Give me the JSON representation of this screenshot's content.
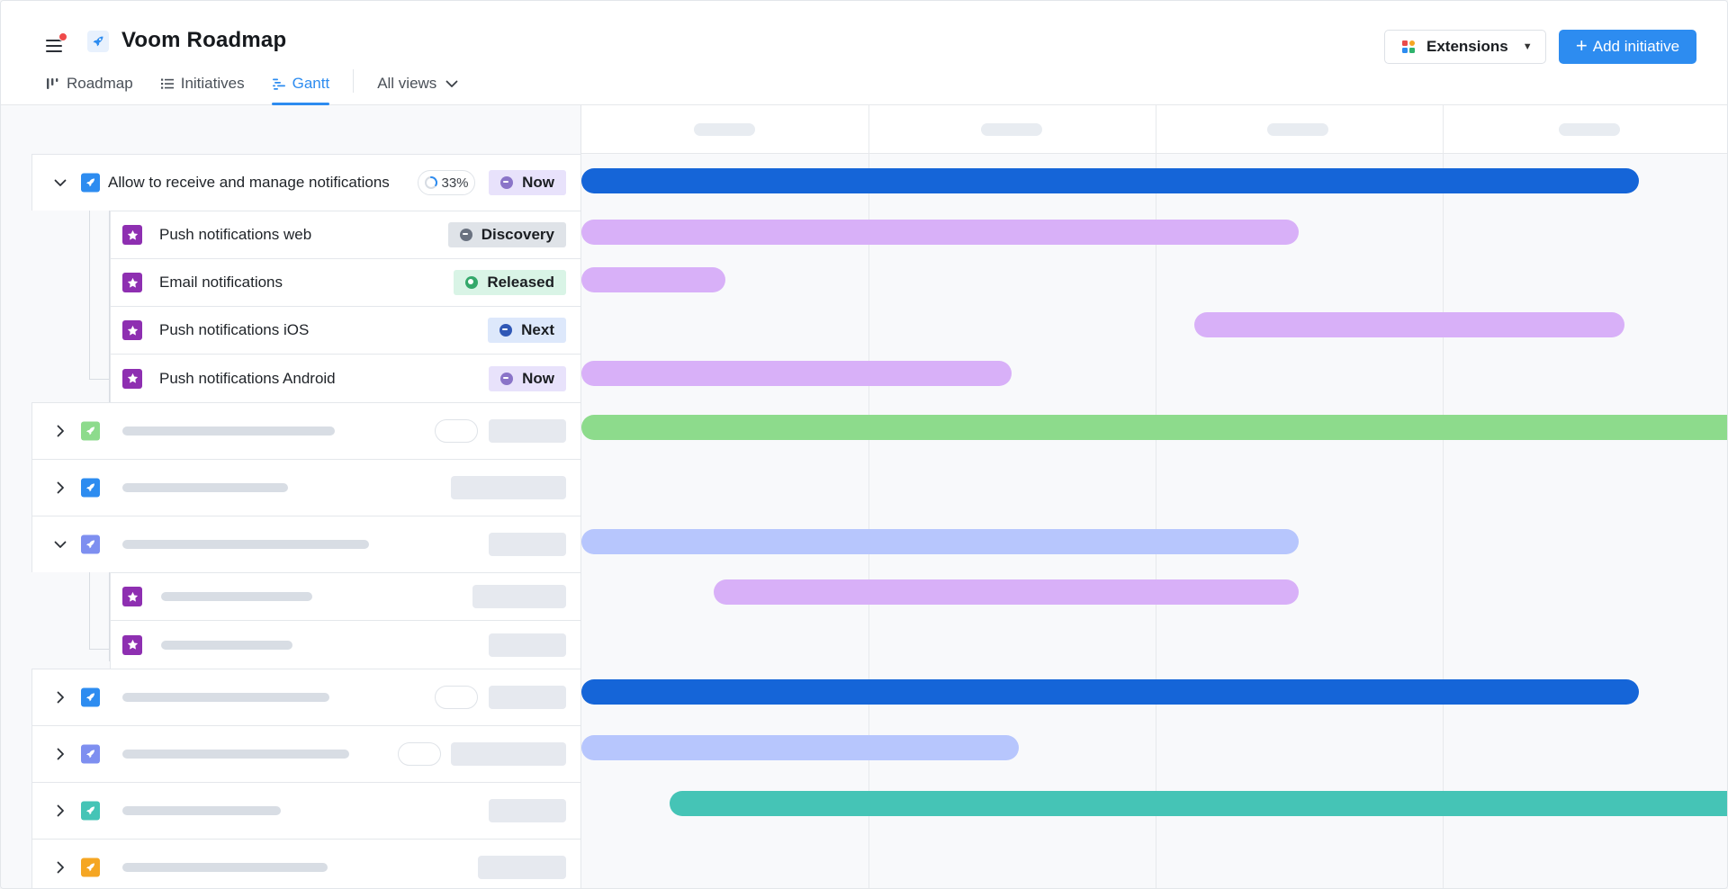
{
  "app": {
    "title": "Voom Roadmap",
    "has_notification": true
  },
  "header": {
    "extensions_label": "Extensions",
    "add_label": "Add initiative"
  },
  "tabs": [
    {
      "label": "Roadmap",
      "icon": "roadmap-icon",
      "active": false
    },
    {
      "label": "Initiatives",
      "icon": "list-icon",
      "active": false
    },
    {
      "label": "Gantt",
      "icon": "gantt-icon",
      "active": true
    }
  ],
  "views_label": "All views",
  "colors": {
    "accent": "#2d8cf0",
    "bar_blue": "#1565d8",
    "bar_purple": "#d8b0f8",
    "bar_green": "#8ddb8c",
    "bar_periwinkle": "#b7c6fd",
    "bar_teal": "#45c4b6",
    "status_now": "#e8e2fb",
    "status_discovery": "#dfe3e8",
    "status_released": "#d9f4e6",
    "status_next": "#dde8fb"
  },
  "initiative": {
    "title": "Allow to receive and manage notifications",
    "progress": "33%",
    "progress_value": 0.33,
    "status": "Now"
  },
  "features": [
    {
      "title": "Push notifications web",
      "status": "Discovery"
    },
    {
      "title": "Email notifications",
      "status": "Released"
    },
    {
      "title": "Push notifications iOS",
      "status": "Next"
    },
    {
      "title": "Push notifications Android",
      "status": "Now"
    }
  ]
}
